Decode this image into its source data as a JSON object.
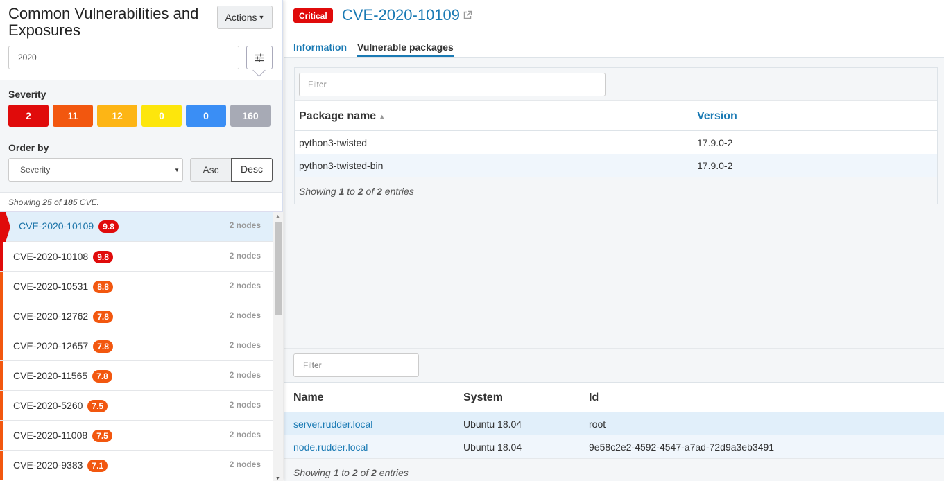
{
  "left": {
    "title": "Common Vulnerabilities and Exposures",
    "actions_label": "Actions",
    "search_value": "2020",
    "severity_label": "Severity",
    "severity_counts": [
      {
        "value": "2",
        "color": "#e00b0b"
      },
      {
        "value": "11",
        "color": "#f2570f"
      },
      {
        "value": "12",
        "color": "#fdb515"
      },
      {
        "value": "0",
        "color": "#fde60c"
      },
      {
        "value": "0",
        "color": "#3a8ef5"
      },
      {
        "value": "160",
        "color": "#a7aab5"
      }
    ],
    "order_label": "Order by",
    "order_value": "Severity",
    "asc_label": "Asc",
    "desc_label": "Desc",
    "showing": {
      "prefix": "Showing ",
      "count": "25",
      "mid": " of ",
      "total": "185",
      "suffix": " CVE."
    },
    "cves": [
      {
        "id": "CVE-2020-10109",
        "score": "9.8",
        "nodes": "2 nodes",
        "color": "#e00b0b",
        "active": true
      },
      {
        "id": "CVE-2020-10108",
        "score": "9.8",
        "nodes": "2 nodes",
        "color": "#e00b0b",
        "active": false
      },
      {
        "id": "CVE-2020-10531",
        "score": "8.8",
        "nodes": "2 nodes",
        "color": "#f2570f",
        "active": false
      },
      {
        "id": "CVE-2020-12762",
        "score": "7.8",
        "nodes": "2 nodes",
        "color": "#f2570f",
        "active": false
      },
      {
        "id": "CVE-2020-12657",
        "score": "7.8",
        "nodes": "2 nodes",
        "color": "#f2570f",
        "active": false
      },
      {
        "id": "CVE-2020-11565",
        "score": "7.8",
        "nodes": "2 nodes",
        "color": "#f2570f",
        "active": false
      },
      {
        "id": "CVE-2020-5260",
        "score": "7.5",
        "nodes": "2 nodes",
        "color": "#f2570f",
        "active": false
      },
      {
        "id": "CVE-2020-11008",
        "score": "7.5",
        "nodes": "2 nodes",
        "color": "#f2570f",
        "active": false
      },
      {
        "id": "CVE-2020-9383",
        "score": "7.1",
        "nodes": "2 nodes",
        "color": "#f2570f",
        "active": false
      }
    ]
  },
  "detail": {
    "badge": "Critical",
    "title": "CVE-2020-10109",
    "tabs": [
      "Information",
      "Vulnerable packages"
    ],
    "packages": {
      "filter_placeholder": "Filter",
      "col_name": "Package name",
      "col_version": "Version",
      "rows": [
        {
          "name": "python3-twisted",
          "version": "17.9.0-2"
        },
        {
          "name": "python3-twisted-bin",
          "version": "17.9.0-2"
        }
      ],
      "showing": {
        "prefix": "Showing ",
        "from": "1",
        "to_word": " to ",
        "to": "2",
        "of_word": " of ",
        "total": "2",
        "suffix": " entries"
      }
    },
    "nodes": {
      "filter_placeholder": "Filter",
      "col_name": "Name",
      "col_system": "System",
      "col_id": "Id",
      "rows": [
        {
          "name": "server.rudder.local",
          "system": "Ubuntu 18.04",
          "id": "root"
        },
        {
          "name": "node.rudder.local",
          "system": "Ubuntu 18.04",
          "id": "9e58c2e2-4592-4547-a7ad-72d9a3eb3491"
        }
      ],
      "showing": {
        "prefix": "Showing ",
        "from": "1",
        "to_word": " to ",
        "to": "2",
        "of_word": " of ",
        "total": "2",
        "suffix": " entries"
      }
    }
  }
}
